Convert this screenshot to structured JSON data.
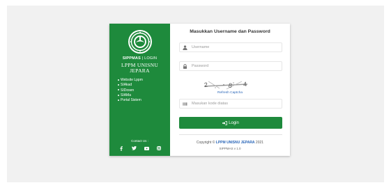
{
  "sidebar": {
    "brand_short": "SIPPMAS",
    "brand_sep": " | ",
    "brand_login": "LOGIN",
    "org_line1": "LPPM UNISNU",
    "org_line2": "JEPARA",
    "menu": [
      {
        "label": "Website Lppm"
      },
      {
        "label": "SIAkad"
      },
      {
        "label": "SIDosen"
      },
      {
        "label": "SIAMa"
      },
      {
        "label": "Portal Sistem"
      }
    ],
    "contact_label": "Contact Us :",
    "socials": [
      "facebook-icon",
      "twitter-icon",
      "youtube-icon",
      "instagram-icon"
    ]
  },
  "form": {
    "title": "Masukkan Username dan Password",
    "username": {
      "value": "",
      "placeholder": "Username"
    },
    "password": {
      "value": "",
      "placeholder": "Password"
    },
    "captcha_text": "2 8 4",
    "refresh_label": "Refresh Captcha",
    "code": {
      "value": "",
      "placeholder": "Masukan kode diatas"
    },
    "login_label": "Login"
  },
  "footer": {
    "copyright_prefix": "Copyright © ",
    "copyright_org": "LPPM UNISNU JEPARA",
    "copyright_year": " 2021",
    "version": "SIPPMAS v 1.0"
  },
  "colors": {
    "brand_green": "#1e8a3c",
    "link_blue": "#2a66b8",
    "background": "#f1f1f1"
  }
}
